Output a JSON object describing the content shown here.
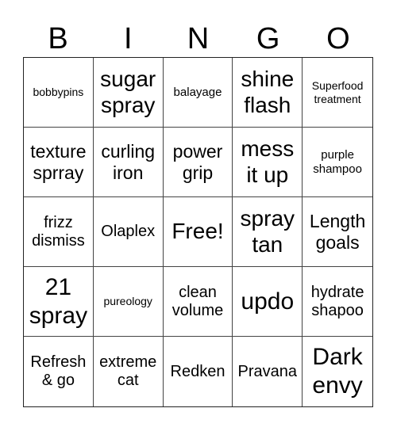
{
  "header": {
    "letters": [
      "B",
      "I",
      "N",
      "G",
      "O"
    ]
  },
  "board": {
    "rows": [
      [
        "bobbypins",
        "sugar spray",
        "balayage",
        "shine flash",
        "Superfood treatment"
      ],
      [
        "texture sprray",
        "curling iron",
        "power grip",
        "mess it up",
        "purple shampoo"
      ],
      [
        "frizz dismiss",
        "Olaplex",
        "Free!",
        "spray tan",
        "Length goals"
      ],
      [
        "21 spray",
        "pureology",
        "clean volume",
        "updo",
        "hydrate shapoo"
      ],
      [
        "Refresh & go",
        "extreme cat",
        "Redken",
        "Pravana",
        "Dark envy"
      ]
    ],
    "free_space": "Free!"
  }
}
